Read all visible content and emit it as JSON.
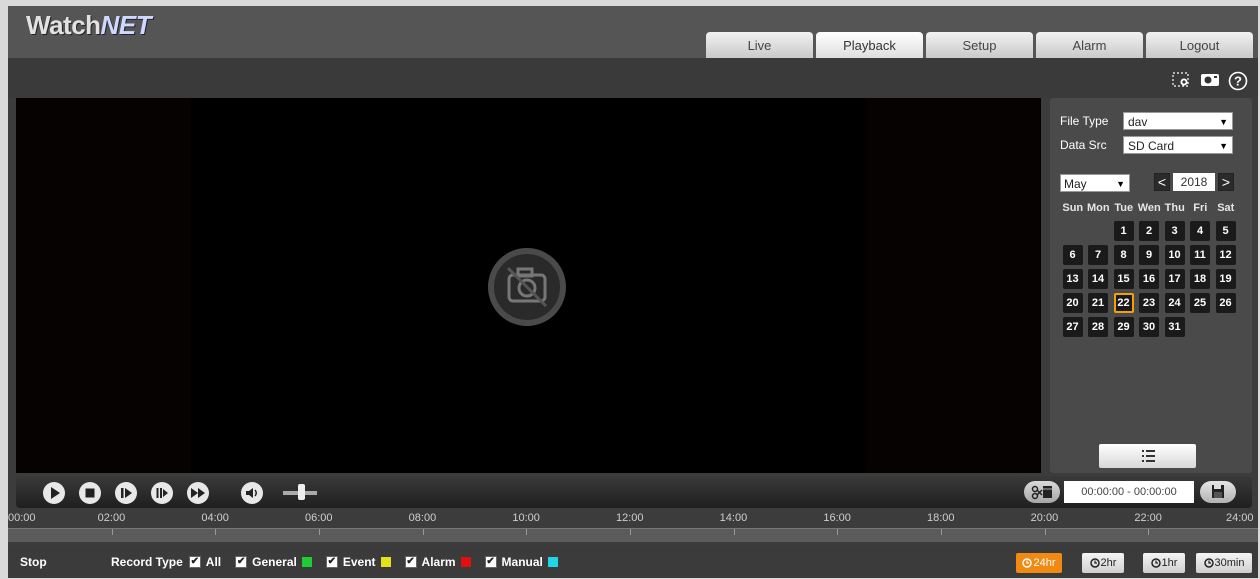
{
  "header": {
    "logo_part1": "Watch",
    "logo_part2": "NET",
    "tabs": [
      {
        "label": "Live"
      },
      {
        "label": "Playback"
      },
      {
        "label": "Setup"
      },
      {
        "label": "Alarm"
      },
      {
        "label": "Logout"
      }
    ],
    "active_tab": "Playback"
  },
  "toolbar_icons": [
    "region-zoom-icon",
    "snapshot-icon",
    "help-icon"
  ],
  "panel": {
    "file_type_label": "File Type",
    "file_type_value": "dav",
    "data_src_label": "Data Src",
    "data_src_value": "SD Card",
    "month_value": "May",
    "prev_year": "<",
    "year_value": "2018",
    "next_year": ">",
    "weekdays": [
      "Sun",
      "Mon",
      "Tue",
      "Wen",
      "Thu",
      "Fri",
      "Sat"
    ],
    "days": [
      "1",
      "2",
      "3",
      "4",
      "5",
      "6",
      "7",
      "8",
      "9",
      "10",
      "11",
      "12",
      "13",
      "14",
      "15",
      "16",
      "17",
      "18",
      "19",
      "20",
      "21",
      "22",
      "23",
      "24",
      "25",
      "26",
      "27",
      "28",
      "29",
      "30",
      "31"
    ],
    "selected_day": "22",
    "list_icon": "file-list-icon"
  },
  "controls": {
    "icons": [
      "play-icon",
      "stop-icon",
      "step-back-icon",
      "slow-icon",
      "fast-forward-icon",
      "volume-icon"
    ],
    "volume_level": 0.45,
    "time_range": "00:00:00 - 00:00:00"
  },
  "timeline": {
    "labels": [
      "00:00",
      "02:00",
      "04:00",
      "06:00",
      "08:00",
      "10:00",
      "12:00",
      "14:00",
      "16:00",
      "18:00",
      "20:00",
      "22:00",
      "24:00"
    ]
  },
  "bottom": {
    "status": "Stop",
    "record_type_label": "Record Type",
    "record_types": [
      {
        "label": "All",
        "checked": true,
        "color": null
      },
      {
        "label": "General",
        "checked": true,
        "color": "#1fcc33"
      },
      {
        "label": "Event",
        "checked": true,
        "color": "#e3e31a"
      },
      {
        "label": "Alarm",
        "checked": true,
        "color": "#e01010"
      },
      {
        "label": "Manual",
        "checked": true,
        "color": "#20d6e6"
      }
    ],
    "zoom_buttons": [
      "24hr",
      "2hr",
      "1hr",
      "30min"
    ],
    "active_zoom": "24hr"
  },
  "colors": {
    "accent": "#f08a13",
    "today_border": "#f2a300"
  }
}
